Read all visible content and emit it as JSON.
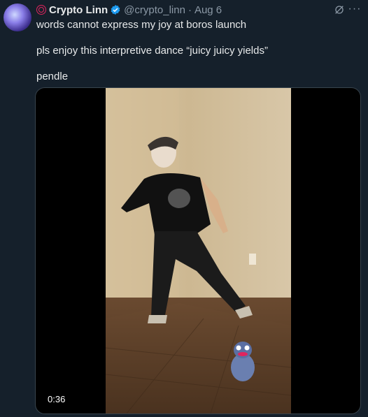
{
  "tweet": {
    "author_name": "Crypto Linn",
    "handle": "@crypto_linn",
    "separator": "·",
    "date": "Aug 6",
    "more_label": "···",
    "paragraphs": [
      "words cannot express my joy at boros launch",
      "pls enjoy this interpretive dance “juicy juicy yields”",
      "pendle"
    ],
    "video_duration": "0:36"
  },
  "icons": {
    "brand": "brand-circle-icon",
    "verified": "verified-badge-icon",
    "grok": "grok-icon",
    "more": "more-options-icon"
  },
  "colors": {
    "background": "#15202b",
    "verified": "#1d9bf0",
    "brand": "#e0245e",
    "muted": "#8b98a5"
  }
}
